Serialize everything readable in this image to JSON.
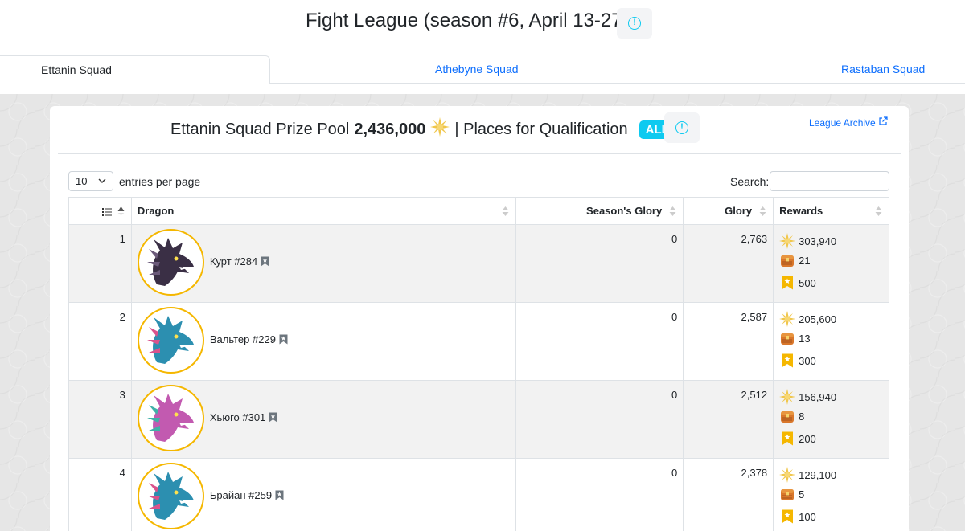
{
  "header": {
    "title": "Fight League (season #6, April 13-27)"
  },
  "tabs": [
    {
      "label": "Ettanin Squad",
      "active": true
    },
    {
      "label": "Athebyne Squad",
      "active": false
    },
    {
      "label": "Rastaban Squad",
      "active": false
    }
  ],
  "prize": {
    "prefix": "Ettanin Squad Prize Pool",
    "amount": "2,436,000",
    "qualification": "| Places for Qualification",
    "badge": "ALL",
    "archive_label": "League Archive"
  },
  "controls": {
    "per_page_value": "10",
    "per_page_label": "entries per page",
    "search_label": "Search:",
    "search_value": ""
  },
  "table": {
    "columns": [
      "",
      "Dragon",
      "Season's Glory",
      "Glory",
      "Rewards"
    ],
    "rows": [
      {
        "rank": "1",
        "name": "Курт #284",
        "season_glory": "0",
        "glory": "2,763",
        "sun": "303,940",
        "chest": "21",
        "ticket": "500",
        "palette": "dark"
      },
      {
        "rank": "2",
        "name": "Вальтер #229",
        "season_glory": "0",
        "glory": "2,587",
        "sun": "205,600",
        "chest": "13",
        "ticket": "300",
        "palette": "teal"
      },
      {
        "rank": "3",
        "name": "Хьюго #301",
        "season_glory": "0",
        "glory": "2,512",
        "sun": "156,940",
        "chest": "8",
        "ticket": "200",
        "palette": "rainbow"
      },
      {
        "rank": "4",
        "name": "Брайан #259",
        "season_glory": "0",
        "glory": "2,378",
        "sun": "129,100",
        "chest": "5",
        "ticket": "100",
        "palette": "teal"
      }
    ]
  },
  "colors": {
    "accent": "#0dcaf0",
    "link": "#0d6efd",
    "avatar_ring": "#f5b700"
  }
}
